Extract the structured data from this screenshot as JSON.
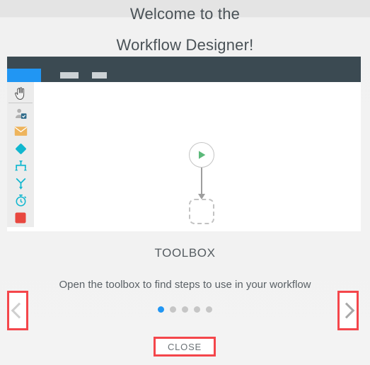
{
  "header": {
    "line1": "Welcome to the",
    "line2": "Workflow Designer!"
  },
  "app": {
    "toolbar": {
      "active_tab_color": "#2196f3",
      "background_color": "#3b4a52",
      "placeholder_color": "#ccd2d5"
    },
    "toolrail": {
      "items": [
        {
          "name": "pointer-hand-icon",
          "label": "Pan / select tool"
        },
        {
          "name": "user-approval-icon",
          "label": "Approval step"
        },
        {
          "name": "email-icon",
          "label": "Email step"
        },
        {
          "name": "decision-diamond-icon",
          "label": "Decision step"
        },
        {
          "name": "merge-icon",
          "label": "Merge step"
        },
        {
          "name": "branch-icon",
          "label": "Branch step"
        },
        {
          "name": "timer-icon",
          "label": "Timer step"
        },
        {
          "name": "stop-icon",
          "label": "Stop step"
        }
      ]
    },
    "canvas": {
      "start_node": {
        "name": "start-node",
        "icon": "play-icon",
        "color": "#5cb97a"
      },
      "drop_node": {
        "name": "drop-placeholder-node",
        "label": ""
      }
    }
  },
  "tour": {
    "title": "TOOLBOX",
    "description": "Open the toolbox to find steps to use in your workflow",
    "dots": {
      "total": 5,
      "active_index": 0
    },
    "prev_label": "Previous",
    "next_label": "Next",
    "close_label": "CLOSE",
    "accent_color": "#f4464b"
  }
}
